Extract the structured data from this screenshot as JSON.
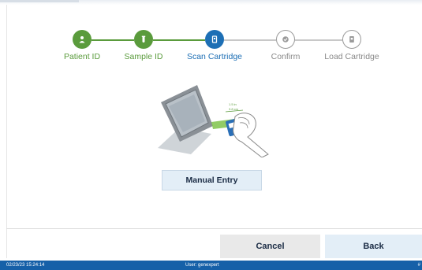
{
  "colors": {
    "complete": "#5a9b3c",
    "current": "#1d6fb5",
    "pending": "#9a9a9a",
    "pending_text": "#8a8a8a",
    "connector_done": "#5a9b3c",
    "connector_todo": "#c8c8c8",
    "statusbar": "#1660a8"
  },
  "stepper": {
    "steps": [
      {
        "label": "Patient ID",
        "state": "complete",
        "icon": "person-icon"
      },
      {
        "label": "Sample ID",
        "state": "complete",
        "icon": "sample-tube-icon"
      },
      {
        "label": "Scan Cartridge",
        "state": "current",
        "icon": "cartridge-icon"
      },
      {
        "label": "Confirm",
        "state": "pending",
        "icon": "check-icon"
      },
      {
        "label": "Load Cartridge",
        "state": "pending",
        "icon": "cartridge-load-icon"
      }
    ]
  },
  "illustration": {
    "icon": "scanner-with-cartridge-illustration",
    "distance_label": "1.5 in / 3.8 cm"
  },
  "actions": {
    "manual_entry": "Manual Entry",
    "cancel": "Cancel",
    "back": "Back"
  },
  "statusbar": {
    "datetime": "02/23/23 15:24:14",
    "user": "User: genexpert",
    "flag": "#"
  }
}
